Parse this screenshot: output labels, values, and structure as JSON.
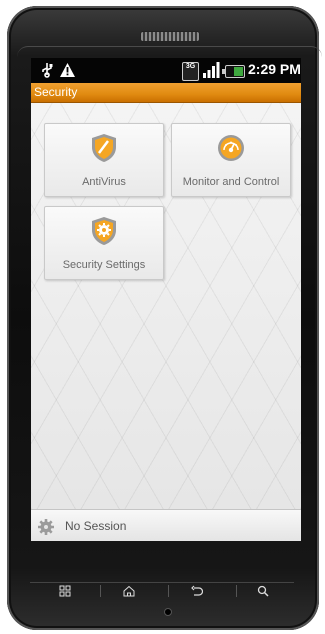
{
  "status_bar": {
    "time": "2:29 PM",
    "network_badge": "3G",
    "icons": [
      "usb-icon",
      "warning-icon",
      "network-3g-icon",
      "signal-icon",
      "battery-icon"
    ]
  },
  "app_bar": {
    "title": "Security",
    "color": "#e08a10"
  },
  "tiles": [
    {
      "label": "AntiVirus",
      "icon": "shield-icon"
    },
    {
      "label": "Monitor and Control",
      "icon": "gauge-icon"
    },
    {
      "label": "Security Settings",
      "icon": "shield-gear-icon"
    }
  ],
  "bottom_bar": {
    "status": "No Session",
    "icon": "gear-icon"
  },
  "hardware_keys": [
    "menu-icon",
    "home-icon",
    "back-icon",
    "search-icon"
  ],
  "colors": {
    "accent_orange": "#f0a030",
    "icon_orange": "#f5a623"
  }
}
